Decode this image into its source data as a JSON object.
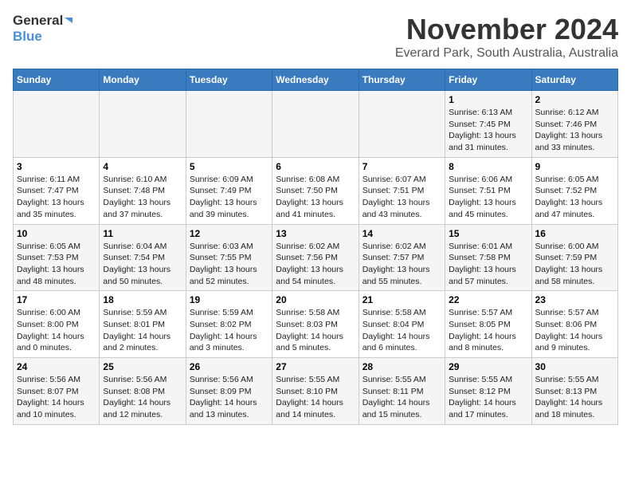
{
  "header": {
    "logo_line1": "General",
    "logo_line2": "Blue",
    "month": "November 2024",
    "location": "Everard Park, South Australia, Australia"
  },
  "weekdays": [
    "Sunday",
    "Monday",
    "Tuesday",
    "Wednesday",
    "Thursday",
    "Friday",
    "Saturday"
  ],
  "weeks": [
    [
      {
        "day": "",
        "info": ""
      },
      {
        "day": "",
        "info": ""
      },
      {
        "day": "",
        "info": ""
      },
      {
        "day": "",
        "info": ""
      },
      {
        "day": "",
        "info": ""
      },
      {
        "day": "1",
        "info": "Sunrise: 6:13 AM\nSunset: 7:45 PM\nDaylight: 13 hours and 31 minutes."
      },
      {
        "day": "2",
        "info": "Sunrise: 6:12 AM\nSunset: 7:46 PM\nDaylight: 13 hours and 33 minutes."
      }
    ],
    [
      {
        "day": "3",
        "info": "Sunrise: 6:11 AM\nSunset: 7:47 PM\nDaylight: 13 hours and 35 minutes."
      },
      {
        "day": "4",
        "info": "Sunrise: 6:10 AM\nSunset: 7:48 PM\nDaylight: 13 hours and 37 minutes."
      },
      {
        "day": "5",
        "info": "Sunrise: 6:09 AM\nSunset: 7:49 PM\nDaylight: 13 hours and 39 minutes."
      },
      {
        "day": "6",
        "info": "Sunrise: 6:08 AM\nSunset: 7:50 PM\nDaylight: 13 hours and 41 minutes."
      },
      {
        "day": "7",
        "info": "Sunrise: 6:07 AM\nSunset: 7:51 PM\nDaylight: 13 hours and 43 minutes."
      },
      {
        "day": "8",
        "info": "Sunrise: 6:06 AM\nSunset: 7:51 PM\nDaylight: 13 hours and 45 minutes."
      },
      {
        "day": "9",
        "info": "Sunrise: 6:05 AM\nSunset: 7:52 PM\nDaylight: 13 hours and 47 minutes."
      }
    ],
    [
      {
        "day": "10",
        "info": "Sunrise: 6:05 AM\nSunset: 7:53 PM\nDaylight: 13 hours and 48 minutes."
      },
      {
        "day": "11",
        "info": "Sunrise: 6:04 AM\nSunset: 7:54 PM\nDaylight: 13 hours and 50 minutes."
      },
      {
        "day": "12",
        "info": "Sunrise: 6:03 AM\nSunset: 7:55 PM\nDaylight: 13 hours and 52 minutes."
      },
      {
        "day": "13",
        "info": "Sunrise: 6:02 AM\nSunset: 7:56 PM\nDaylight: 13 hours and 54 minutes."
      },
      {
        "day": "14",
        "info": "Sunrise: 6:02 AM\nSunset: 7:57 PM\nDaylight: 13 hours and 55 minutes."
      },
      {
        "day": "15",
        "info": "Sunrise: 6:01 AM\nSunset: 7:58 PM\nDaylight: 13 hours and 57 minutes."
      },
      {
        "day": "16",
        "info": "Sunrise: 6:00 AM\nSunset: 7:59 PM\nDaylight: 13 hours and 58 minutes."
      }
    ],
    [
      {
        "day": "17",
        "info": "Sunrise: 6:00 AM\nSunset: 8:00 PM\nDaylight: 14 hours and 0 minutes."
      },
      {
        "day": "18",
        "info": "Sunrise: 5:59 AM\nSunset: 8:01 PM\nDaylight: 14 hours and 2 minutes."
      },
      {
        "day": "19",
        "info": "Sunrise: 5:59 AM\nSunset: 8:02 PM\nDaylight: 14 hours and 3 minutes."
      },
      {
        "day": "20",
        "info": "Sunrise: 5:58 AM\nSunset: 8:03 PM\nDaylight: 14 hours and 5 minutes."
      },
      {
        "day": "21",
        "info": "Sunrise: 5:58 AM\nSunset: 8:04 PM\nDaylight: 14 hours and 6 minutes."
      },
      {
        "day": "22",
        "info": "Sunrise: 5:57 AM\nSunset: 8:05 PM\nDaylight: 14 hours and 8 minutes."
      },
      {
        "day": "23",
        "info": "Sunrise: 5:57 AM\nSunset: 8:06 PM\nDaylight: 14 hours and 9 minutes."
      }
    ],
    [
      {
        "day": "24",
        "info": "Sunrise: 5:56 AM\nSunset: 8:07 PM\nDaylight: 14 hours and 10 minutes."
      },
      {
        "day": "25",
        "info": "Sunrise: 5:56 AM\nSunset: 8:08 PM\nDaylight: 14 hours and 12 minutes."
      },
      {
        "day": "26",
        "info": "Sunrise: 5:56 AM\nSunset: 8:09 PM\nDaylight: 14 hours and 13 minutes."
      },
      {
        "day": "27",
        "info": "Sunrise: 5:55 AM\nSunset: 8:10 PM\nDaylight: 14 hours and 14 minutes."
      },
      {
        "day": "28",
        "info": "Sunrise: 5:55 AM\nSunset: 8:11 PM\nDaylight: 14 hours and 15 minutes."
      },
      {
        "day": "29",
        "info": "Sunrise: 5:55 AM\nSunset: 8:12 PM\nDaylight: 14 hours and 17 minutes."
      },
      {
        "day": "30",
        "info": "Sunrise: 5:55 AM\nSunset: 8:13 PM\nDaylight: 14 hours and 18 minutes."
      }
    ]
  ]
}
